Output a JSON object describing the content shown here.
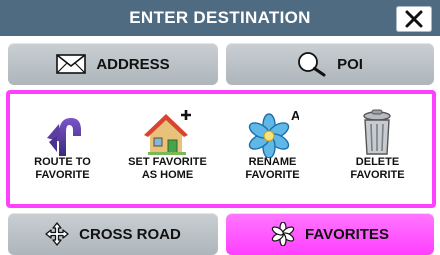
{
  "header": {
    "title": "ENTER DESTINATION",
    "close_label": "✕"
  },
  "tabs": {
    "address": {
      "label": "ADDRESS",
      "icon": "envelope-icon"
    },
    "poi": {
      "label": "POI",
      "icon": "search-icon"
    },
    "cross_road": {
      "label": "CROSS ROAD",
      "icon": "crossroad-arrows-icon"
    },
    "favorites": {
      "label": "FAVORITES",
      "icon": "favorites-icon",
      "active": true
    }
  },
  "actions": [
    {
      "line1": "ROUTE TO",
      "line2": "FAVORITE",
      "icon": "route-arrow-icon"
    },
    {
      "line1": "SET FAVORITE",
      "line2": "AS HOME",
      "icon": "house-plus-icon"
    },
    {
      "line1": "RENAME",
      "line2": "FAVORITE",
      "icon": "flower-a-icon"
    },
    {
      "line1": "DELETE",
      "line2": "FAVORITE",
      "icon": "trash-can-icon"
    }
  ],
  "colors": {
    "header_bg": "#4f6b82",
    "accent_magenta": "#ff40ff",
    "tab_gray": "#bcc3c7"
  }
}
